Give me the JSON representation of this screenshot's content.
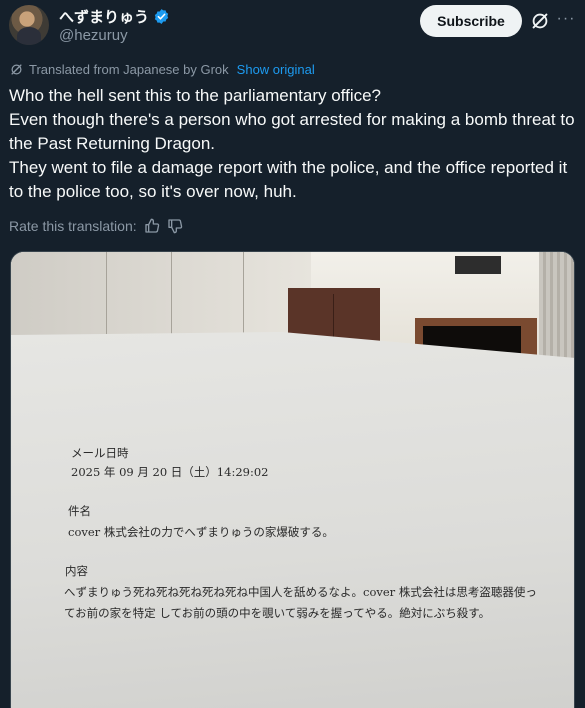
{
  "header": {
    "display_name": "へずまりゅう",
    "handle": "@hezuruy",
    "subscribe_label": "Subscribe",
    "more_label": "···"
  },
  "translation": {
    "note": "Translated from Japanese by Grok",
    "show_original": "Show original",
    "rate_label": "Rate this translation:"
  },
  "tweet": {
    "lines": [
      "Who the hell sent this to the parliamentary office?",
      "Even though there's a person who got arrested for making a bomb threat to the Past Returning Dragon.",
      "They went to file a damage report with the police, and the office reported it to the police too, so it's over now, huh."
    ]
  },
  "photo_document": {
    "date_label": "メール日時",
    "date_value": "2025 年 09 月 20 日（土）14:29:02",
    "subject_label": "件名",
    "subject_value": "cover 株式会社の力でへずまりゅうの家爆破する。",
    "body_label": "内容",
    "body_line_1": "へずまりゅう死ね死ね死ね死ね死ね中国人を舐めるなよ。cover 株式会社は思考盗聴器使っ",
    "body_line_2": "てお前の家を特定 してお前の頭の中を覗いて弱みを握ってやる。絶対にぶち殺す。"
  },
  "colors": {
    "background": "#15202b",
    "text": "#f7f9f9",
    "muted": "#8b98a5",
    "link": "#1d9bf0",
    "verified": "#1d9bf0"
  },
  "icons": [
    "verified-badge-icon",
    "grok-icon",
    "more-icon",
    "thumbs-up-icon",
    "thumbs-down-icon"
  ]
}
